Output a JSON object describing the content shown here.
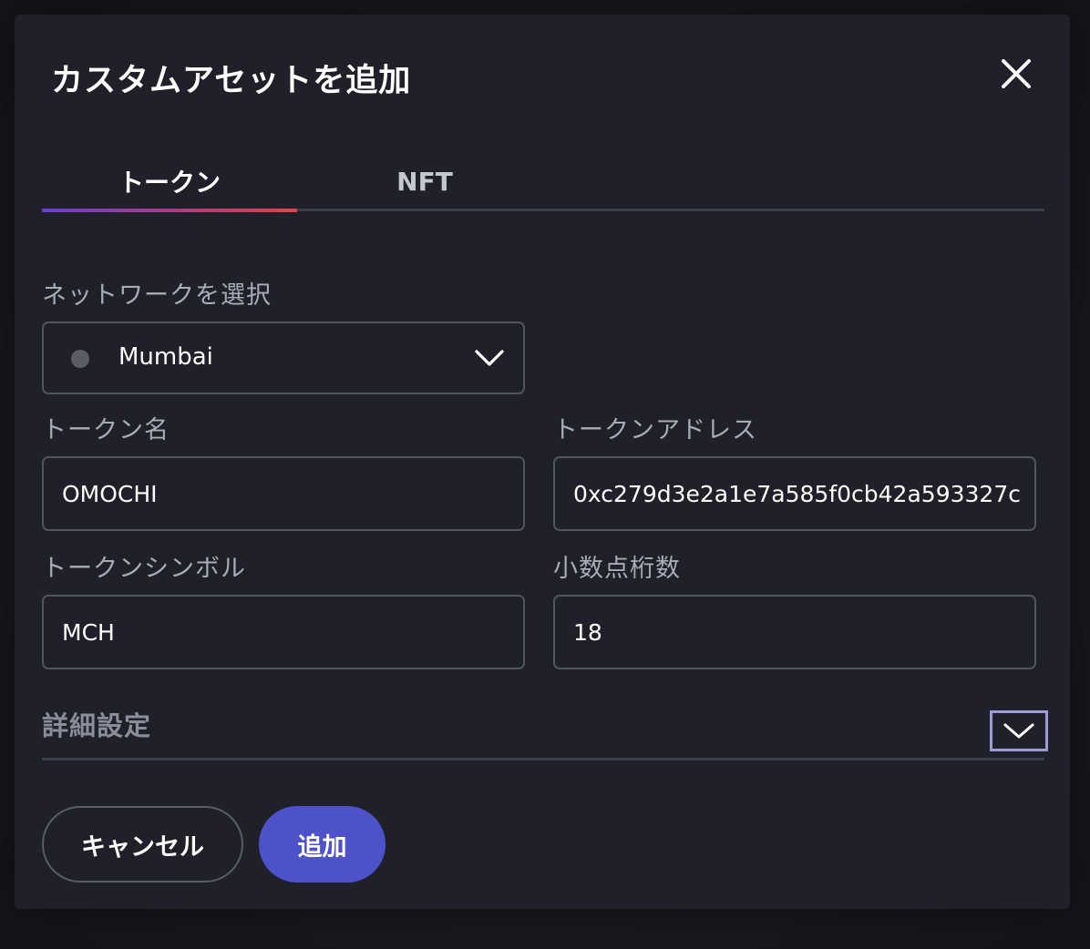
{
  "dialog": {
    "title": "カスタムアセットを追加",
    "close_icon": "close-icon"
  },
  "tabs": [
    {
      "label": "トークン",
      "active": true
    },
    {
      "label": "NFT",
      "active": false
    }
  ],
  "network": {
    "label": "ネットワークを選択",
    "selected": "Mumbai",
    "status_color": "#5b5c64"
  },
  "form": {
    "token_name": {
      "label": "トークン名",
      "value": "OMOCHI"
    },
    "token_address": {
      "label": "トークンアドレス",
      "value": "0xc279d3e2a1e7a585f0cb42a593327c"
    },
    "token_symbol": {
      "label": "トークンシンボル",
      "value": "MCH"
    },
    "decimals": {
      "label": "小数点桁数",
      "value": "18"
    }
  },
  "advanced": {
    "label": "詳細設定",
    "expanded": false
  },
  "buttons": {
    "cancel": "キャンセル",
    "add": "追加"
  },
  "colors": {
    "accent": "#4e52c8",
    "modal_bg": "#1f2029",
    "tab_gradient_start": "#6a3fd0",
    "tab_gradient_end": "#e04448"
  }
}
